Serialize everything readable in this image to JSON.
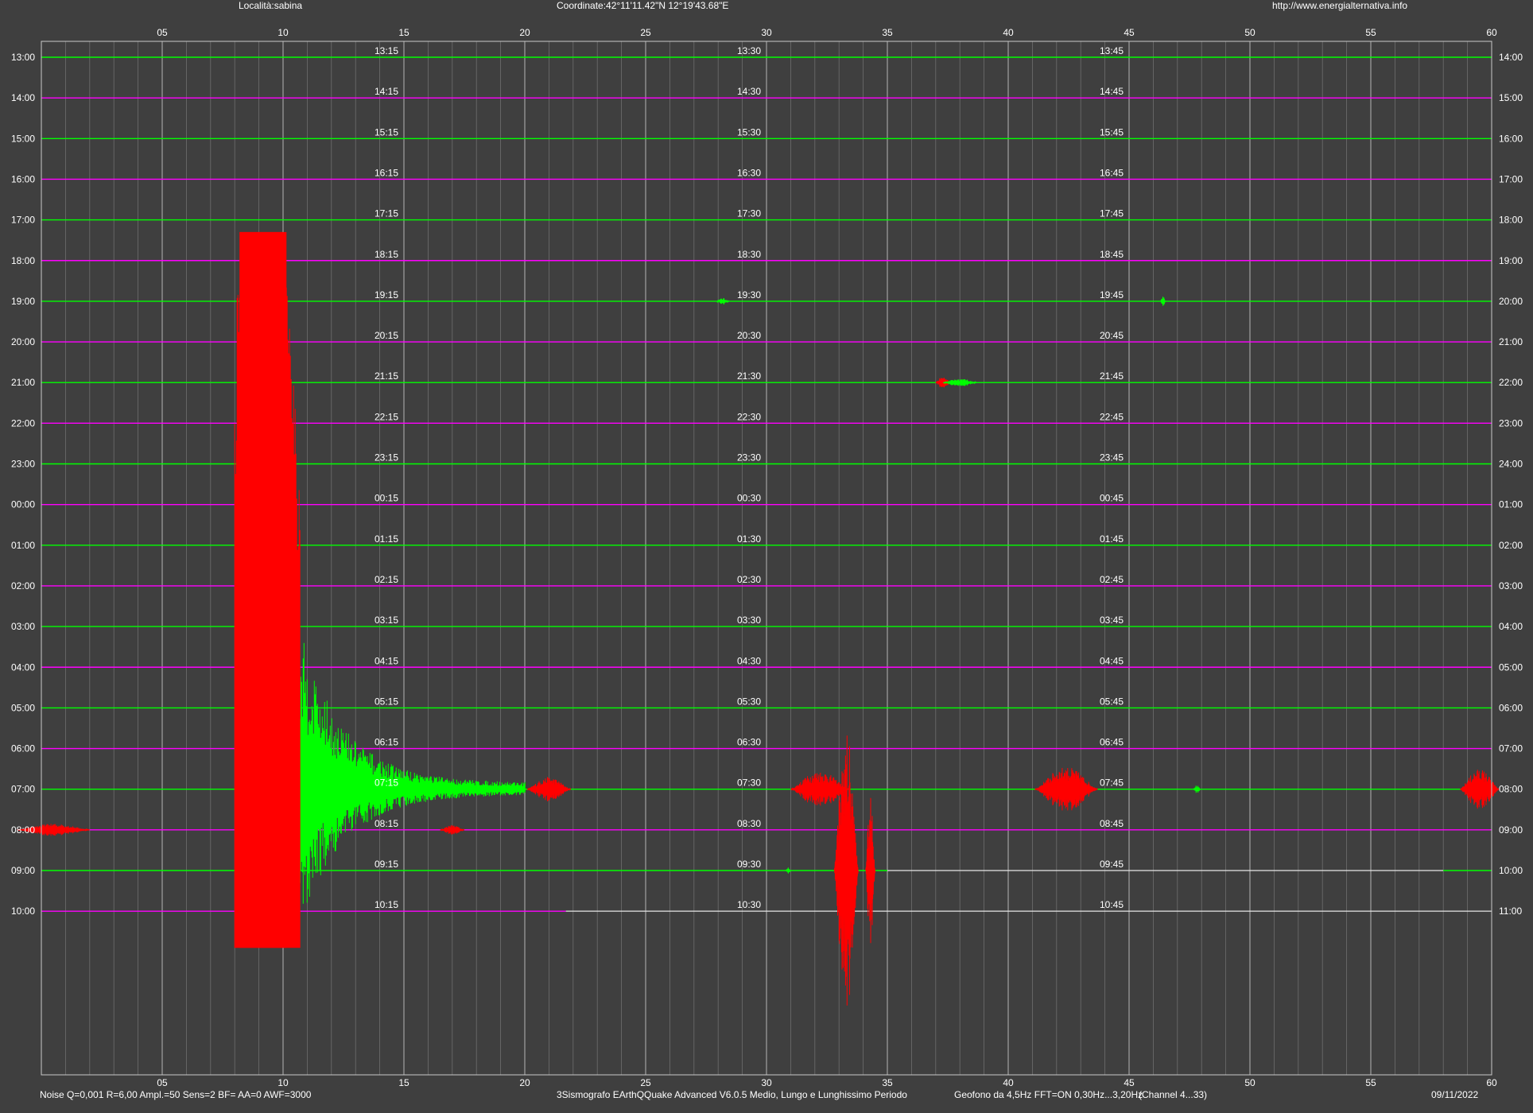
{
  "header": {
    "location": "Località:sabina",
    "coordinates": "Coordinate:42°11'11.42\"N  12°19'43.68\"E",
    "website": "http://www.energialternativa.info"
  },
  "footer": {
    "settings": "Noise Q=0,001 R=6,00 Ampl.=50 Sens=2 BF= AA=0 AWF=3000",
    "software": "3Sismografo  EArthQQuake Advanced V6.0.5  Medio, Lungo e Lunghissimo Periodo",
    "sensor": "Geofono da 4,5Hz FFT=ON 0,30Hz...3,20Hz",
    "channel": "(Channel 4...33)",
    "date": "09/11/2022"
  },
  "colors": {
    "background": "#3f3f3f",
    "plot_border": "#c8c8c8",
    "grid_minor": "#6e6e6e",
    "grid_major": "#b4b4b4",
    "trace_green": "#00ff00",
    "trace_magenta": "#ff00ff",
    "event_red": "#ff0000",
    "flat_trace": "#e6e6e6"
  },
  "chart_data": {
    "type": "line",
    "xlim": [
      0,
      60
    ],
    "x_ticks": [
      "05",
      "10",
      "15",
      "20",
      "25",
      "30",
      "35",
      "40",
      "45",
      "50",
      "55",
      "60"
    ],
    "left_hour_labels": [
      "13:00",
      "14:00",
      "15:00",
      "16:00",
      "17:00",
      "18:00",
      "19:00",
      "20:00",
      "21:00",
      "22:00",
      "23:00",
      "00:00",
      "01:00",
      "02:00",
      "03:00",
      "04:00",
      "05:00",
      "06:00",
      "07:00",
      "08:00",
      "09:00",
      "10:00"
    ],
    "right_hour_labels": [
      "14:00",
      "15:00",
      "16:00",
      "17:00",
      "18:00",
      "19:00",
      "20:00",
      "21:00",
      "22:00",
      "23:00",
      "24:00",
      "01:00",
      "02:00",
      "03:00",
      "04:00",
      "05:00",
      "06:00",
      "07:00",
      "08:00",
      "09:00",
      "10:00",
      "11:00"
    ],
    "quarter_labels_15": [
      "13:15",
      "14:15",
      "15:15",
      "16:15",
      "17:15",
      "18:15",
      "19:15",
      "20:15",
      "21:15",
      "22:15",
      "23:15",
      "00:15",
      "01:15",
      "02:15",
      "03:15",
      "04:15",
      "05:15",
      "06:15",
      "07:15",
      "08:15",
      "09:15",
      "10:15"
    ],
    "quarter_labels_30": [
      "13:30",
      "14:30",
      "15:30",
      "16:30",
      "17:30",
      "18:30",
      "19:30",
      "20:30",
      "21:30",
      "22:30",
      "23:30",
      "00:30",
      "01:30",
      "02:30",
      "03:30",
      "04:30",
      "05:30",
      "06:30",
      "07:30",
      "08:30",
      "09:30",
      "10:30"
    ],
    "quarter_labels_45": [
      "13:45",
      "14:45",
      "15:45",
      "16:45",
      "17:45",
      "18:45",
      "19:45",
      "20:45",
      "21:45",
      "22:45",
      "23:45",
      "00:45",
      "01:45",
      "02:45",
      "03:45",
      "04:45",
      "05:45",
      "06:45",
      "07:45",
      "08:45",
      "09:45",
      "10:45"
    ],
    "traces": [
      {
        "row": 0,
        "color": "green",
        "end": 60
      },
      {
        "row": 1,
        "color": "magenta",
        "end": 60
      },
      {
        "row": 2,
        "color": "green",
        "end": 60
      },
      {
        "row": 3,
        "color": "magenta",
        "end": 60
      },
      {
        "row": 4,
        "color": "green",
        "end": 60
      },
      {
        "row": 5,
        "color": "magenta",
        "end": 60
      },
      {
        "row": 6,
        "color": "green",
        "end": 60
      },
      {
        "row": 7,
        "color": "magenta",
        "end": 60
      },
      {
        "row": 8,
        "color": "green",
        "end": 60
      },
      {
        "row": 9,
        "color": "magenta",
        "end": 60
      },
      {
        "row": 10,
        "color": "green",
        "end": 60
      },
      {
        "row": 11,
        "color": "magenta",
        "end": 60
      },
      {
        "row": 12,
        "color": "green",
        "end": 60
      },
      {
        "row": 13,
        "color": "magenta",
        "end": 60
      },
      {
        "row": 14,
        "color": "green",
        "end": 60
      },
      {
        "row": 15,
        "color": "magenta",
        "end": 60
      },
      {
        "row": 16,
        "color": "green",
        "end": 60
      },
      {
        "row": 17,
        "color": "magenta",
        "end": 60
      },
      {
        "row": 18,
        "color": "green",
        "end": 60
      },
      {
        "row": 19,
        "color": "magenta",
        "end": 60
      },
      {
        "row": 20,
        "color": "green",
        "end": 60,
        "flat_from": 35,
        "flat_to": 58
      },
      {
        "row": 21,
        "color": "magenta",
        "end": 21.7,
        "flat_to": 60
      }
    ],
    "events": [
      {
        "row": 6,
        "x": 28.2,
        "half_width": 0.25,
        "amplitude_rows": 0.08,
        "color": "green"
      },
      {
        "row": 6,
        "x": 46.4,
        "half_width": 0.1,
        "amplitude_rows": 0.12,
        "color": "green"
      },
      {
        "row": 8,
        "x": 37.3,
        "half_width": 0.3,
        "amplitude_rows": 0.15,
        "color": "red"
      },
      {
        "row": 8,
        "x": 38.0,
        "half_width": 0.7,
        "amplitude_rows": 0.1,
        "color": "green"
      },
      {
        "row": 18,
        "x": 21.0,
        "half_width": 0.9,
        "amplitude_rows": 0.3,
        "color": "red"
      },
      {
        "row": 18,
        "x": 32.2,
        "half_width": 1.2,
        "amplitude_rows": 0.45,
        "color": "red"
      },
      {
        "row": 18,
        "x": 42.4,
        "half_width": 1.3,
        "amplitude_rows": 0.55,
        "color": "red"
      },
      {
        "row": 18,
        "x": 47.8,
        "half_width": 0.15,
        "amplitude_rows": 0.1,
        "color": "green"
      },
      {
        "row": 18,
        "x": 59.5,
        "half_width": 0.8,
        "amplitude_rows": 0.5,
        "color": "red"
      },
      {
        "row": 19,
        "x": 0.5,
        "half_width": 1.5,
        "amplitude_rows": 0.15,
        "color": "red"
      },
      {
        "row": 19,
        "x": 17.0,
        "half_width": 0.5,
        "amplitude_rows": 0.12,
        "color": "red"
      },
      {
        "row": 20,
        "x": 33.3,
        "half_width": 0.5,
        "amplitude_rows": 3.5,
        "color": "red"
      },
      {
        "row": 20,
        "x": 34.3,
        "half_width": 0.2,
        "amplitude_rows": 1.8,
        "color": "red"
      },
      {
        "row": 20,
        "x": 30.9,
        "half_width": 0.1,
        "amplitude_rows": 0.08,
        "color": "green"
      }
    ],
    "main_quake": {
      "red_block": {
        "x_start": 8.0,
        "x_end": 10.7,
        "row_top": 4.3,
        "row_bottom": 21.9
      },
      "green_coda": {
        "row": 18,
        "x_start": 10.7,
        "x_end": 20.0,
        "amplitude_rows": 4.0
      }
    }
  }
}
